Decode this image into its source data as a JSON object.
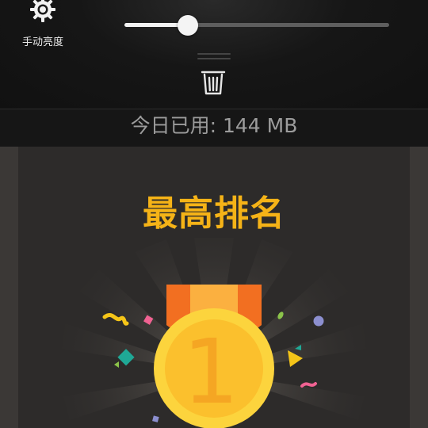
{
  "shade": {
    "brightness_label": "手动亮度",
    "brightness_level": 0.24,
    "brightness_icon": "brightness-gear-icon",
    "clear_icon": "trash-icon",
    "usage_text": "今日已用: 144 MB"
  },
  "main": {
    "title": "最高排名",
    "medal_number": "1",
    "colors": {
      "title": "#f5b317",
      "ribbon": "#f7941d",
      "medal_outer": "#fcd43d",
      "medal_inner": "#fbc02d",
      "medal_number": "#f5a623"
    },
    "confetti_icons": [
      "squiggle-yellow",
      "diamond-pink",
      "diamond-teal",
      "triangle-green",
      "leaf-green",
      "dot-purple",
      "triangle-yellow",
      "squiggle-pink",
      "square-blue"
    ]
  }
}
